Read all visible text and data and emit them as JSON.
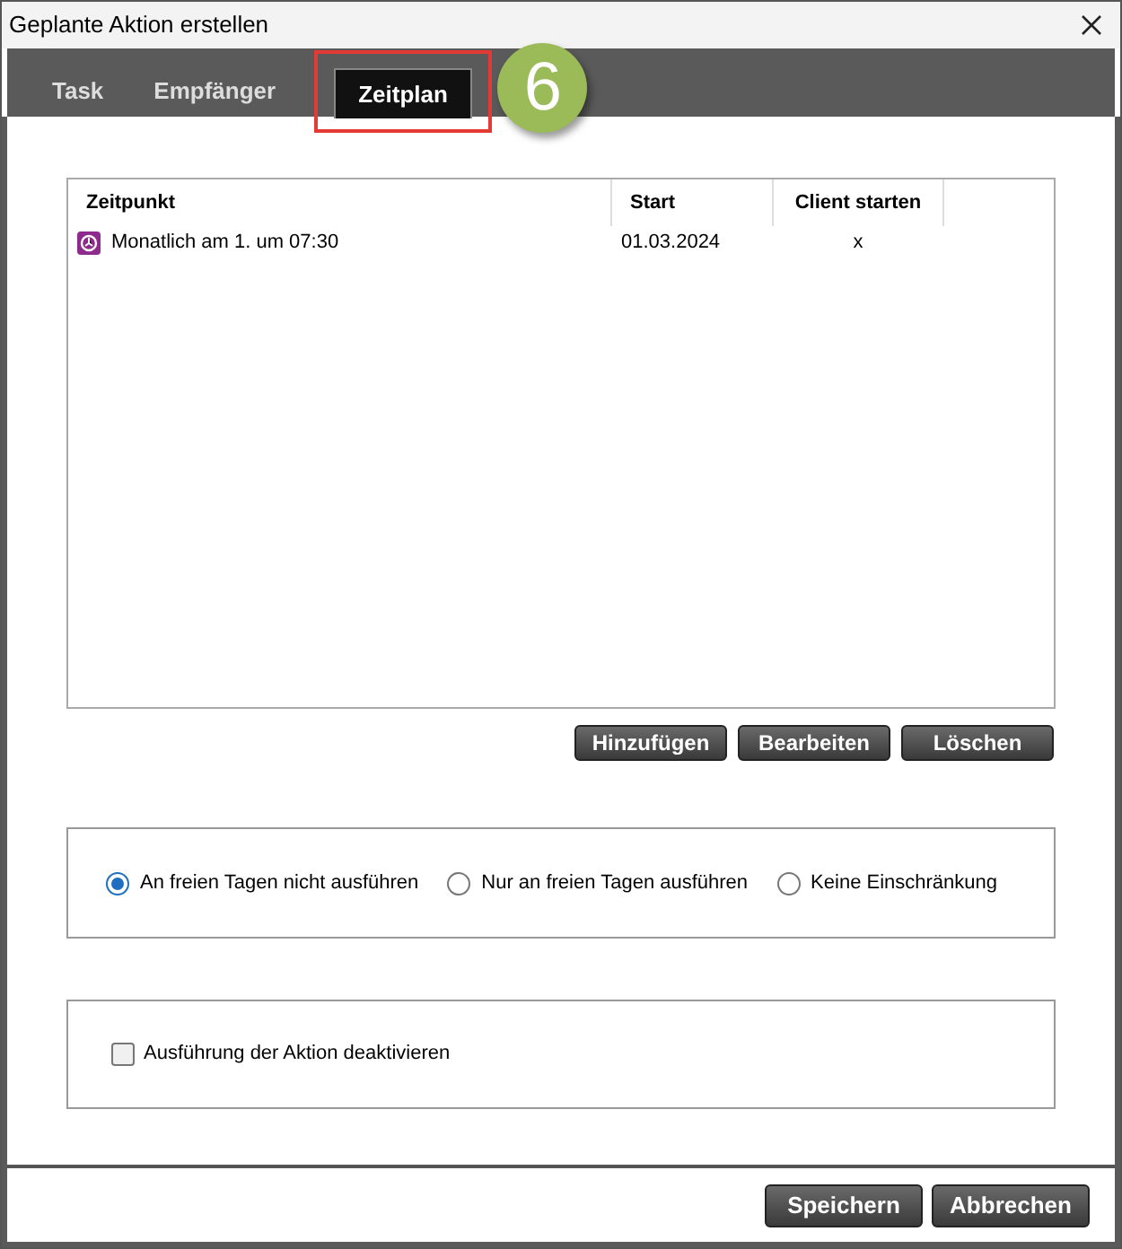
{
  "window": {
    "title": "Geplante Aktion erstellen"
  },
  "tabs": [
    {
      "label": "Task",
      "selected": false
    },
    {
      "label": "Empfänger",
      "selected": false
    },
    {
      "label": "Zeitplan",
      "selected": true
    }
  ],
  "callout": {
    "number": "6"
  },
  "table": {
    "columns": [
      "Zeitpunkt",
      "Start",
      "Client starten"
    ],
    "rows": [
      {
        "cells": [
          "Monatlich am 1. um 07:30",
          "01.03.2024",
          "x"
        ]
      }
    ]
  },
  "table_buttons": [
    "Hinzufügen",
    "Bearbeiten",
    "Löschen"
  ],
  "day_options": [
    {
      "label": "An freien Tagen nicht ausführen",
      "selected": true
    },
    {
      "label": "Nur an freien Tagen ausführen",
      "selected": false
    },
    {
      "label": "Keine Einschränkung",
      "selected": false
    }
  ],
  "disable_option": {
    "label": "Ausführung der Aktion deaktivieren",
    "checked": false
  },
  "footer_buttons": [
    "Speichern",
    "Abbrechen"
  ]
}
